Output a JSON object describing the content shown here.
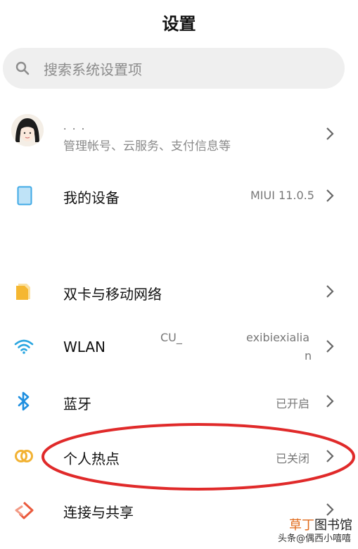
{
  "header": {
    "title": "设置"
  },
  "search": {
    "placeholder": "搜索系统设置项"
  },
  "account": {
    "name": "· · ·",
    "subtitle": "管理帐号、云服务、支付信息等"
  },
  "device": {
    "label": "我的设备",
    "value": "MIUI 11.0.5"
  },
  "network_items": [
    {
      "label": "双卡与移动网络",
      "value": "",
      "icon": "sim-card-icon",
      "color": "#f5b731"
    },
    {
      "label": "WLAN",
      "value_left": "CU_",
      "value_right_line1": "exibiexialia",
      "value_right_line2": "n",
      "icon": "wifi-icon",
      "color": "#2aa6e0"
    },
    {
      "label": "蓝牙",
      "value": "已开启",
      "icon": "bluetooth-icon",
      "color": "#1e8fe0"
    },
    {
      "label": "个人热点",
      "value": "已关闭",
      "icon": "hotspot-icon",
      "color": "#f2b233"
    },
    {
      "label": "连接与共享",
      "value": "",
      "icon": "connection-share-icon",
      "color": "#ea5a3d"
    }
  ],
  "watermark": {
    "brand_part1": "草丁",
    "brand_part2": "图书馆",
    "sub": "头条@偶西小嘻嘻"
  },
  "colors": {
    "accent_oval": "#e02a2a",
    "device_icon": "#3fa9e6"
  }
}
